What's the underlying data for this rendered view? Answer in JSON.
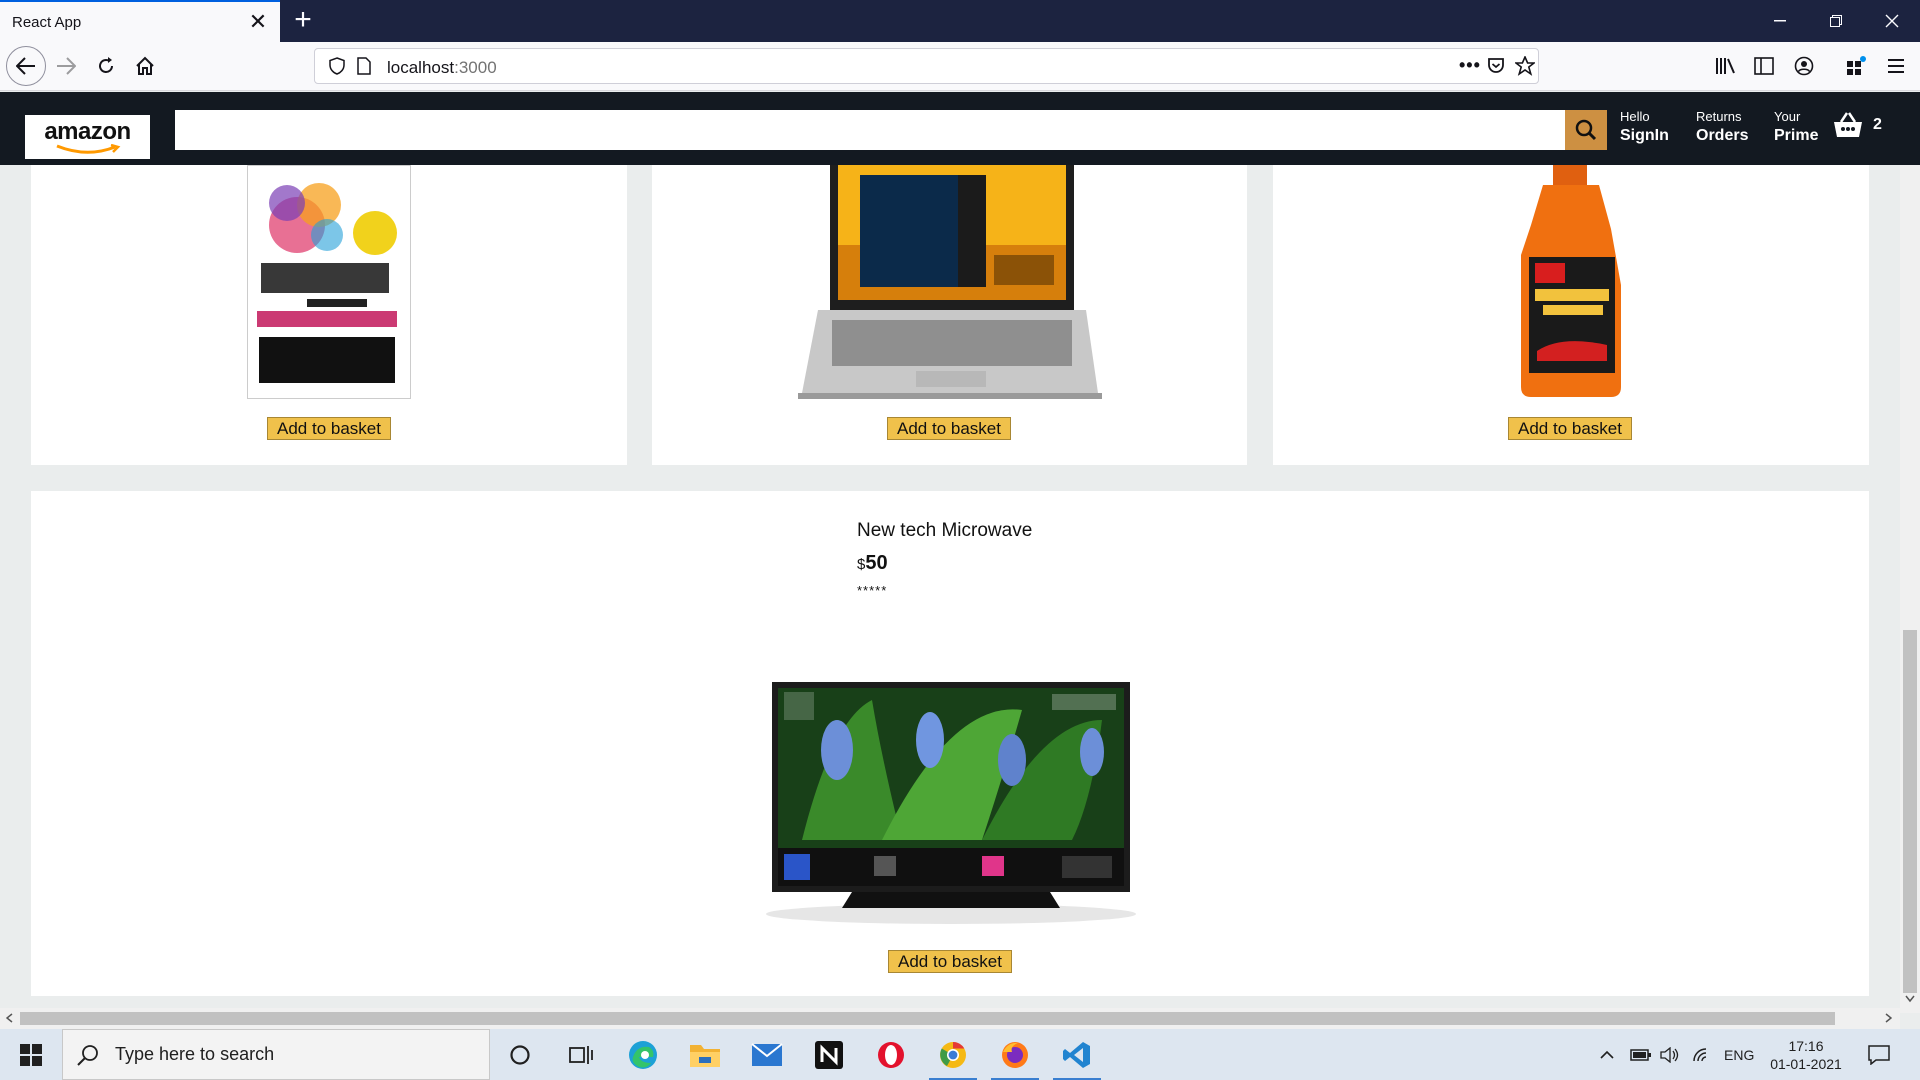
{
  "browser": {
    "tab_title": "React App",
    "tab_close": "✕",
    "new_tab": "+",
    "url_host": "localhost",
    "url_port": ":3000",
    "more_menu": "•••"
  },
  "amazon": {
    "logo_text": "amazon",
    "search_placeholder": "",
    "header_options": [
      {
        "line1": "Hello",
        "line2": "SignIn"
      },
      {
        "line1": "Returns",
        "line2": "Orders"
      },
      {
        "line1": "Your",
        "line2": "Prime"
      }
    ],
    "basket_count": "2"
  },
  "products": {
    "row1": [
      {
        "image_name": "book-power-of-subconscious-mind",
        "button_label": "Add to basket"
      },
      {
        "image_name": "laptop",
        "button_label": "Add to basket"
      },
      {
        "image_name": "car-wash-shampoo",
        "button_label": "Add to basket"
      }
    ],
    "featured": {
      "title": "New tech Microwave",
      "price_symbol": "$",
      "price_value": "50",
      "rating": "*****",
      "button_label": "Add to basket"
    }
  },
  "taskbar": {
    "search_placeholder": "Type here to search",
    "language": "ENG",
    "time": "17:16",
    "date": "01-01-2021"
  }
}
